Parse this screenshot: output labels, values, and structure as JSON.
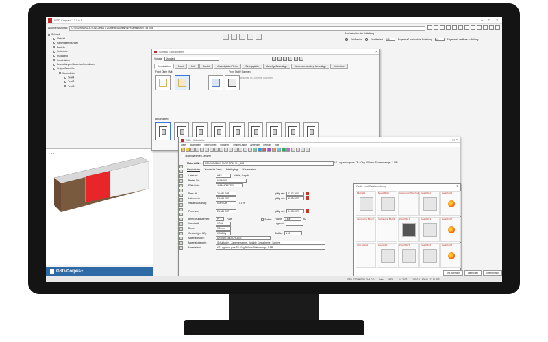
{
  "window": {
    "title": "GSD-Corpus+ 12.0.0.8"
  },
  "pathbar": {
    "label": "Aktueller Auswahl",
    "value": "C:\\GSD\\KALKULATION\\Corpus 4.2\\Objekte\\Möbel\\Pos\\Prozessmöbel 158 .xxx"
  },
  "right_panel": {
    "title": "Maßdefinition der Aufteilung",
    "option1": "Feldbasiert",
    "option2": "Frontbasiert",
    "value1": "0.5",
    "text1": "Fugenmaß horizontale Aufteilung",
    "value2": "0.5",
    "text2": "Fugenmaß vertikale Aufteilung"
  },
  "tree": {
    "items": [
      {
        "label": "Schrank",
        "level": 0
      },
      {
        "label": "Material",
        "level": 1
      },
      {
        "label": "Kantenaufleimungen",
        "level": 1
      },
      {
        "label": "Bauteile",
        "level": 1
      },
      {
        "label": "Seitenteile",
        "level": 1
      },
      {
        "label": "Rückwand",
        "level": 1
      },
      {
        "label": "Konstruktion",
        "level": 1
      },
      {
        "label": "Bearbeitungen/Bauteilverformationen",
        "level": 1
      },
      {
        "label": "Gruppe/Baureihe",
        "level": 1
      },
      {
        "label": "Korpusfelder",
        "level": 2
      },
      {
        "label": "Feld 1",
        "level": 3,
        "selected": true
      },
      {
        "label": "Feld 2",
        "level": 3
      },
      {
        "label": "Feld 3",
        "level": 3
      }
    ]
  },
  "axes": [
    "x",
    "y",
    "z"
  ],
  "schrank_dialog": {
    "title": "Schrank Eigenschaften",
    "vorlage_label": "Vorlage",
    "vorlage_value": "Standard",
    "tabs": [
      "Konstruktion",
      "Front",
      "Griff",
      "Sockel",
      "Abdeckplatte/Pfeiler",
      "Einlegeplatte",
      "Auszüge/Beschläge",
      "Kantenverwendung Beschläge",
      "Korbmöbel"
    ],
    "section_front": "Front Ohne / Mit",
    "section_feld": "Front Statt / Rahmen",
    "checkbox_label": "Auszug/Beschlag im Lochreihe ausrichten",
    "section_beschlag": "Beschlagtyp"
  },
  "kalk": {
    "title": "GSD - Kalkulation",
    "menu": [
      "Datei",
      "Bearbeiten",
      "Übersichten",
      "Optionen",
      "Online-Daten",
      "Anzeigen",
      "Fenster",
      "Hilfe"
    ],
    "subtitle": "Materialanlegen / ändern",
    "materialnr_label": "Material-Nr.:",
    "materialnr_value": "KS LEGRABOX PURE TP40 N L_158",
    "right_title": "KS Legrabox pure TP 40kg 500mm Stufenmenge: 1 PR",
    "subtabs": [
      "Materialdaten",
      "Technische Daten",
      "Arbeitsgänge",
      "Kostenstellen"
    ],
    "fields": [
      {
        "label": "Lieferant:",
        "value": "HAE",
        "extra": "Häfele, Nagold"
      },
      {
        "label": "Bestell-Nr.:",
        "value": "55146580"
      },
      {
        "label": "EAN-Code:",
        "value": "4016647297759"
      },
      {
        "label": "Preis alt:",
        "value": "24.030 EUR"
      },
      {
        "label": "Listenpreis:",
        "value": "24.400 EUR"
      },
      {
        "label": "Rabatt/Aufschlag:",
        "value": "0.00 EUR",
        "extra": "0.0 %"
      },
      {
        "label": "Preis neu:",
        "value": "24.060 EUR"
      },
      {
        "label": "Berechnungseinheit:",
        "value": "Pr",
        "extra": "Paar"
      },
      {
        "label": "Verschnitt:",
        "value": "0.0 %"
      },
      {
        "label": "Dicke:",
        "value": "0.0 mm"
      },
      {
        "label": "Gewicht (pro BE):",
        "value": "0.000 Kg"
      },
      {
        "label": "Materialgruppe:",
        "value": "UKOSBELBESCHLÄGE"
      },
      {
        "label": "Materialkategorie:",
        "value": "Schubladen - Zargensysteme - Variable Korpusbreite - Schiene"
      },
      {
        "label": "Materialtext:",
        "value": "KS Legrabox pure TP 40kg 500mm Stufenmenge: 1 PR"
      }
    ],
    "right_fields": [
      {
        "label": "gültig seit:",
        "value": "23.12.2021"
      },
      {
        "label": "gültig seit:",
        "value": "10.05.2023"
      },
      {
        "label": "gültig seit:",
        "value": "04.03.2023"
      },
      {
        "label": "Fläche:",
        "value": "3.600",
        "unit": "m2"
      },
      {
        "label": "Lagerort:",
        "value": ""
      },
      {
        "label": "Stafflim:",
        "value": "1.00"
      }
    ],
    "rabatt_check": "Rabatt",
    "footer": "©2018 GSD Softwarecenter GmbH"
  },
  "bilder": {
    "title": "Grafik- und Dateizuordnung",
    "cells": [
      {
        "label": "Bildpfad 1",
        "pic": "drawer-rail"
      },
      {
        "label": "Bestell Bilder",
        "pic": "drawer-rail"
      },
      {
        "label": "Internetzugriffbeschreib.",
        "pic": "empty"
      },
      {
        "label": "Zusatzbild 2",
        "pic": "drawer-part"
      },
      {
        "label": "Zusatzbild 4",
        "pic": "firefox"
      },
      {
        "label": "Verbrauchte Bild 2D",
        "pic": "empty"
      },
      {
        "label": "Verbrauchte Bild 3D",
        "pic": "empty"
      },
      {
        "label": "Zusatzbild 1",
        "pic": "drawer-box"
      },
      {
        "label": "Zusatzbild 3",
        "pic": "drawer-part"
      },
      {
        "label": "Zusatzbild 7",
        "pic": "firefox"
      },
      {
        "label": "CAD-Schmel",
        "pic": "empty"
      },
      {
        "label": "Zusatzbild 4",
        "pic": "drawer-rail"
      },
      {
        "label": "Zusatzbild 5",
        "pic": "drawer-part"
      },
      {
        "label": "Zusatzbild 6",
        "pic": "drawer-part"
      },
      {
        "label": "Zusatzbild 8",
        "pic": "firefox"
      }
    ]
  },
  "logo": "GSD-Corpus+",
  "statusbar": [
    "GSD-ETTLINGEN-CHILD-0",
    "kbo",
    "933-",
    "2.8.2022",
    "120.0.0 - 40042 - 12.11.2021"
  ],
  "bottom_buttons": [
    "und Beenden",
    "abbrechen",
    "übernehmen"
  ]
}
